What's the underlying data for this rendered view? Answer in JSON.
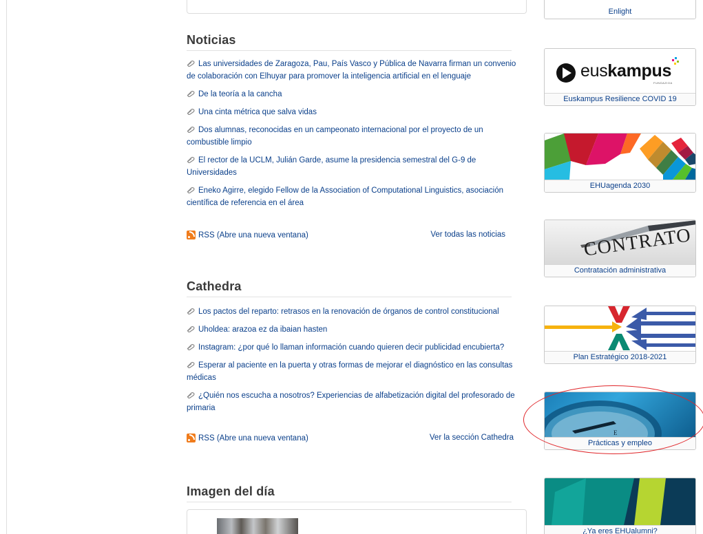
{
  "news": {
    "title": "Noticias",
    "items": [
      "Las universidades de Zaragoza, Pau, País Vasco y Pública de Navarra firman un convenio de colaboración con Elhuyar para promover la inteligencia artificial en el lenguaje",
      "De la teoría a la cancha",
      "Una cinta métrica que salva vidas",
      "Dos alumnas, reconocidas en un campeonato internacional por el proyecto de un combustible limpio",
      "El rector de la UCLM, Julián Garde, asume la presidencia semestral del G-9 de Universidades",
      "Eneko Agirre, elegido Fellow de la Association of Computational Linguistics, asociación científica de referencia en el área"
    ],
    "rss_label": "RSS (Abre una nueva ventana)",
    "more_label": "Ver todas las noticias"
  },
  "cathedra": {
    "title": "Cathedra",
    "items": [
      "Los pactos del reparto: retrasos en la renovación de órganos de control constitucional",
      "Uholdea: arazoa ez da ibaian hasten",
      "Instagram: ¿por qué lo llaman información cuando quieren decir publicidad encubierta?",
      "Esperar al paciente en la puerta y otras formas de mejorar el diagnóstico en las consultas médicas",
      "¿Quién nos escucha a nosotros? Experiencias de alfabetización digital del profesorado de primaria"
    ],
    "rss_label": "RSS (Abre una nueva ventana)",
    "more_label": "Ver la sección Cathedra"
  },
  "image_of_day": {
    "title": "Imagen del día"
  },
  "banners": [
    {
      "caption": "Enlight"
    },
    {
      "caption": "Euskampus Resilience COVID 19",
      "logo_text_light": "eus",
      "logo_text_bold": "kampus",
      "logo_sub": "FUNDAZIOA"
    },
    {
      "caption": "EHUagenda 2030"
    },
    {
      "caption": "Contratación administrativa",
      "image_text": "CONTRATO"
    },
    {
      "caption": "Plan Estratégico 2018-2021"
    },
    {
      "caption": "Prácticas y empleo"
    },
    {
      "caption": "¿Ya eres EHUalumni?"
    }
  ],
  "colors": {
    "link": "#0a3f8a",
    "heading": "#3a3a3a",
    "rss": "#f07c1c",
    "highlight": "#e0262a"
  }
}
